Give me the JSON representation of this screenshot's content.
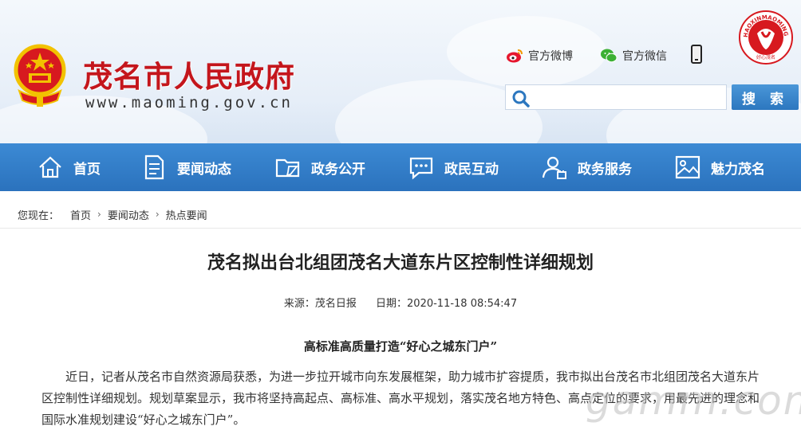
{
  "header": {
    "site_title": "茂名市人民政府",
    "site_url": "www.maoming.gov.cn",
    "weibo_label": "官方微博",
    "wechat_label": "官方微信",
    "seal_text": "HAOXINMAOMING",
    "seal_caption": "好心茂名",
    "search_placeholder": "",
    "search_button": "搜 索"
  },
  "nav": {
    "items": [
      {
        "label": "首页",
        "icon": "home-icon"
      },
      {
        "label": "要闻动态",
        "icon": "document-icon"
      },
      {
        "label": "政务公开",
        "icon": "folder-icon"
      },
      {
        "label": "政民互动",
        "icon": "chat-icon"
      },
      {
        "label": "政务服务",
        "icon": "user-service-icon"
      },
      {
        "label": "魅力茂名",
        "icon": "picture-icon"
      }
    ]
  },
  "breadcrumb": {
    "prefix": "您现在：",
    "items": [
      "首页",
      "要闻动态",
      "热点要闻"
    ]
  },
  "article": {
    "title": "茂名拟出台北组团茂名大道东片区控制性详细规划",
    "source": "来源：茂名日报",
    "date": "日期：2020-11-18 08:54:47",
    "subheading": "高标准高质量打造“好心之城东门户”",
    "paragraph": "近日，记者从茂名市自然资源局获悉，为进一步拉开城市向东发展框架，助力城市扩容提质，我市拟出台茂名市北组团茂名大道东片区控制性详细规划。规划草案显示，我市将坚持高起点、高标准、高水平规划，落实茂名地方特色、高点定位的要求，用最先进的理念和国际水准规划建设“好心之城东门户”。"
  },
  "watermark": "gamm.com",
  "colors": {
    "title_red": "#c4161c",
    "nav_blue": "#2b72bd",
    "button_blue": "#2c77bf"
  }
}
